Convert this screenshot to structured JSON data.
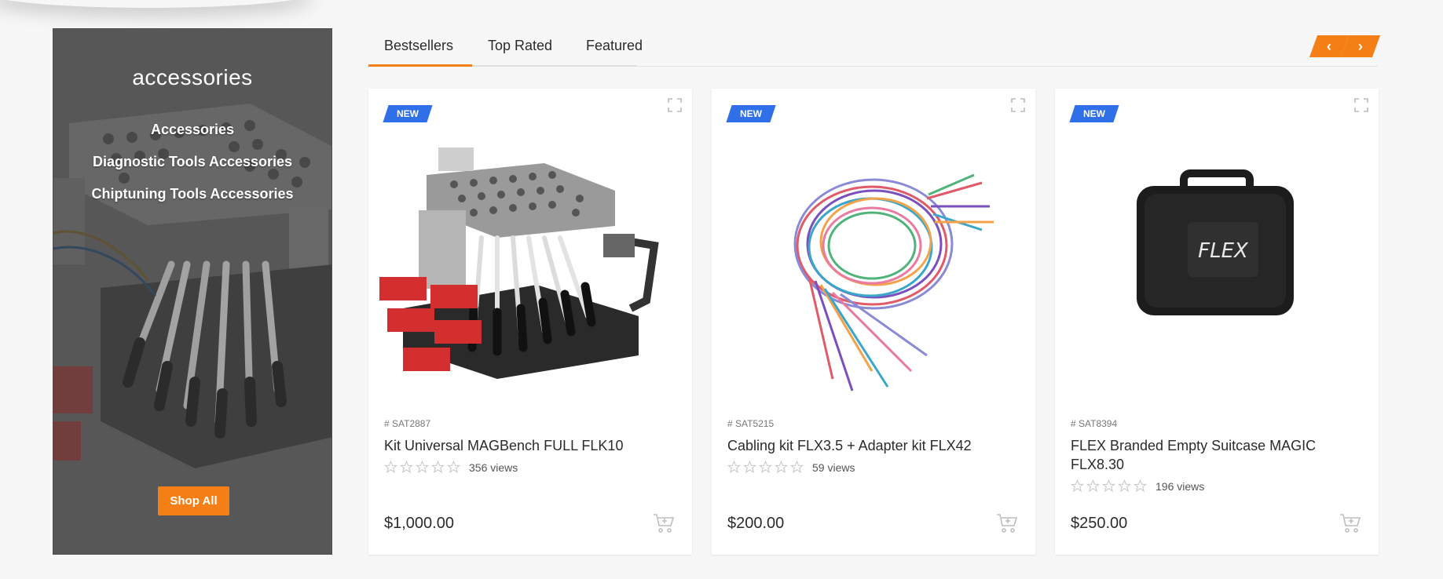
{
  "category": {
    "title": "accessories",
    "links": [
      "Accessories",
      "Diagnostic Tools Accessories",
      "Chiptuning Tools Accessories"
    ],
    "shop_all_label": "Shop All"
  },
  "tabs": [
    "Bestsellers",
    "Top Rated",
    "Featured"
  ],
  "active_tab": "Bestsellers",
  "nav": {
    "prev_icon": "chevron-left-icon",
    "next_icon": "chevron-right-icon"
  },
  "products": [
    {
      "badge": "NEW",
      "sku": "# SAT2887",
      "name": "Kit Universal MAGBench FULL FLK10",
      "rating": 0,
      "views": "356 views",
      "price": "$1,000.00"
    },
    {
      "badge": "NEW",
      "sku": "# SAT5215",
      "name": "Cabling kit FLX3.5 + Adapter kit FLX42",
      "rating": 0,
      "views": "59 views",
      "price": "$200.00"
    },
    {
      "badge": "NEW",
      "sku": "# SAT8394",
      "name": "FLEX Branded Empty Suitcase MAGIC FLX8.30",
      "rating": 0,
      "views": "196 views",
      "price": "$250.00"
    }
  ],
  "brand_text_on_case": "FLEX",
  "colors": {
    "accent": "#f57f17",
    "badge": "#2f6fe8",
    "banner": "#5c5c5c"
  }
}
